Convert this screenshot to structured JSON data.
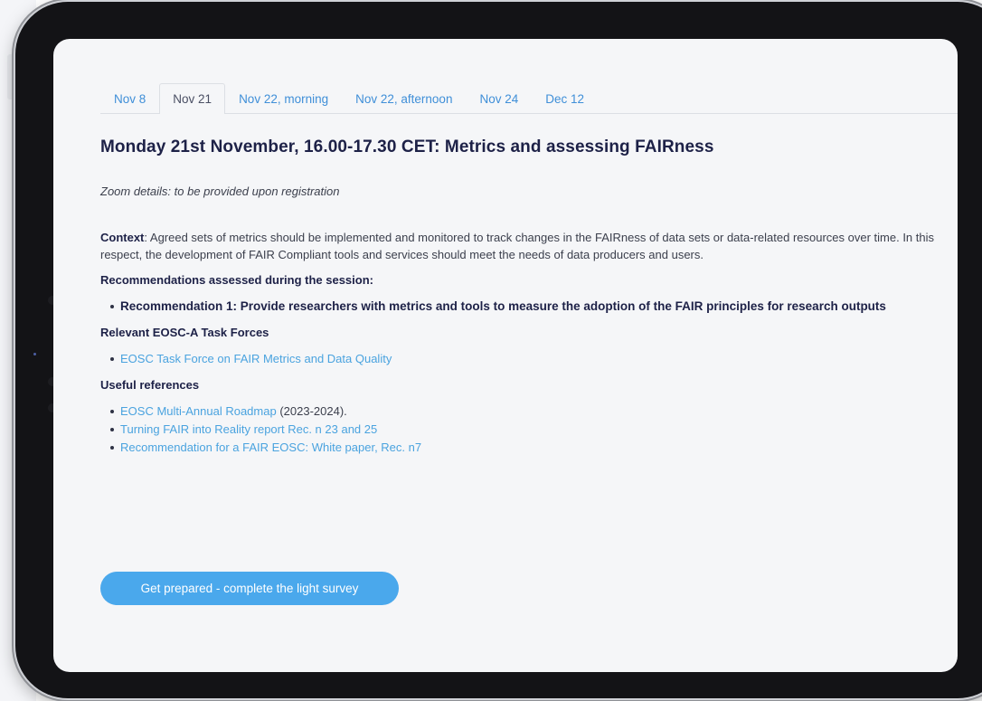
{
  "tabs": [
    {
      "label": "Nov 8"
    },
    {
      "label": "Nov 21"
    },
    {
      "label": "Nov 22, morning"
    },
    {
      "label": "Nov 22, afternoon"
    },
    {
      "label": "Nov 24"
    },
    {
      "label": "Dec 12"
    }
  ],
  "active_tab": "Nov 21",
  "session": {
    "title": "Monday 21st November, 16.00-17.30 CET: Metrics and assessing FAIRness",
    "zoom_note": "Zoom details: to be provided upon registration",
    "context_label": "Context",
    "context_text": ": Agreed sets of metrics should be implemented and monitored to track changes in the FAIRness of data sets or data-related resources over time. In this respect, the development of FAIR Compliant tools and services should meet the needs of data producers and users.",
    "recommendations_heading": "Recommendations assessed during the session:",
    "recommendations": [
      "Recommendation 1:  Provide researchers with metrics and tools to measure the adoption of the FAIR principles for research outputs"
    ],
    "task_forces_heading": "Relevant EOSC-A Task Forces",
    "task_forces": [
      {
        "link": "EOSC Task Force on FAIR Metrics and Data Quality"
      }
    ],
    "references_heading": "Useful references",
    "references": [
      {
        "link": "EOSC Multi-Annual Roadmap",
        "suffix": " (2023-2024)."
      },
      {
        "link": "Turning FAIR into Reality report  Rec. n 23 and 25",
        "suffix": ""
      },
      {
        "link": "Recommendation for a FAIR EOSC: White paper, Rec. n7",
        "suffix": ""
      }
    ],
    "cta_label": "Get prepared - complete the light survey"
  },
  "colors": {
    "link": "#4aa3df",
    "heading": "#1d2147",
    "button": "#4aa8ec",
    "bezel": "#131316"
  }
}
